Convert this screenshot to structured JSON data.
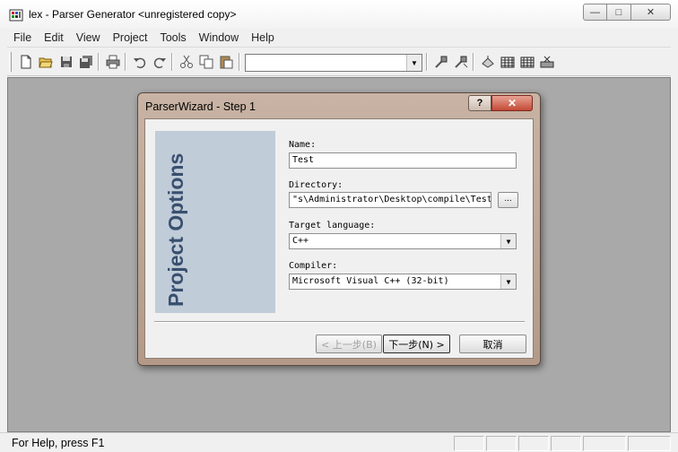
{
  "window": {
    "title": "lex - Parser Generator <unregistered copy>",
    "min_glyph": "—",
    "max_glyph": "□",
    "close_glyph": "✕"
  },
  "menu": [
    "File",
    "Edit",
    "View",
    "Project",
    "Tools",
    "Window",
    "Help"
  ],
  "toolbar": {
    "combo_value": "",
    "combo_arrow": "▼",
    "icons": [
      "new-file-icon",
      "open-folder-icon",
      "save-icon",
      "save-all-icon",
      "print-icon",
      "undo-icon",
      "redo-icon",
      "cut-icon",
      "copy-icon",
      "paste-icon",
      "build-icon",
      "rebuild-icon",
      "wizard-icon",
      "grid-icon",
      "grid2-icon",
      "clean-icon"
    ]
  },
  "dialog": {
    "title": "ParserWizard - Step 1",
    "help_glyph": "?",
    "close_glyph": "✕",
    "side_panel_text": "Project Options",
    "name_label": "Name:",
    "name_value": "Test",
    "directory_label": "Directory:",
    "directory_value": "\"s\\Administrator\\Desktop\\compile\\Test",
    "browse_label": "...",
    "target_language_label": "Target language:",
    "target_language_value": "C++",
    "compiler_label": "Compiler:",
    "compiler_value": "Microsoft Visual C++ (32-bit)",
    "combo_arrow": "▼",
    "back_button": "< 上一步(B)",
    "next_button": "下一步(N) >",
    "cancel_button": "取消"
  },
  "status": {
    "text": "For Help, press F1"
  }
}
